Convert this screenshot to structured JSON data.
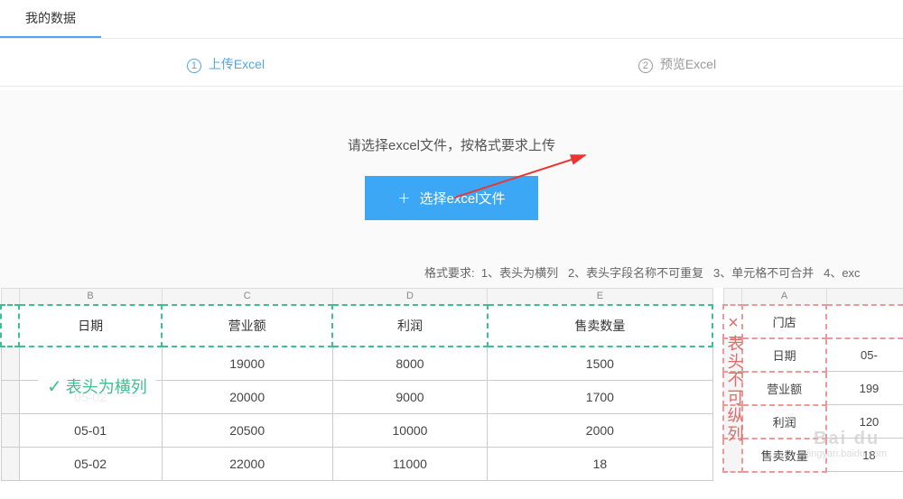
{
  "nav": {
    "tab": "我的数据"
  },
  "steps": {
    "s1": "上传Excel",
    "s2": "预览Excel"
  },
  "main": {
    "hint": "请选择excel文件，按格式要求上传",
    "button": "选择excel文件"
  },
  "format": {
    "prefix": "格式要求:",
    "r1": "1、表头为横列",
    "r2": "2、表头字段名称不可重复",
    "r3": "3、单元格不可合并",
    "r4": "4、exc"
  },
  "correct": {
    "badge": "表头为横列",
    "cols": [
      "B",
      "C",
      "D",
      "E"
    ],
    "headers": [
      "日期",
      "营业额",
      "利润",
      "售卖数量"
    ],
    "rows": [
      [
        "",
        "19000",
        "8000",
        "1500"
      ],
      [
        "05-02",
        "20000",
        "9000",
        "1700"
      ],
      [
        "05-01",
        "20500",
        "10000",
        "2000"
      ],
      [
        "05-02",
        "22000",
        "11000",
        "18"
      ]
    ]
  },
  "incorrect": {
    "badge": "表头不可纵列",
    "cols": [
      "A",
      ""
    ],
    "rows": [
      [
        "门店",
        ""
      ],
      [
        "日期",
        "05-"
      ],
      [
        "营业额",
        "199"
      ],
      [
        "利润",
        "120"
      ],
      [
        "售卖数量",
        "18"
      ]
    ]
  },
  "watermark": {
    "big": "Bai du",
    "small": "jingyan.baidu.com"
  }
}
